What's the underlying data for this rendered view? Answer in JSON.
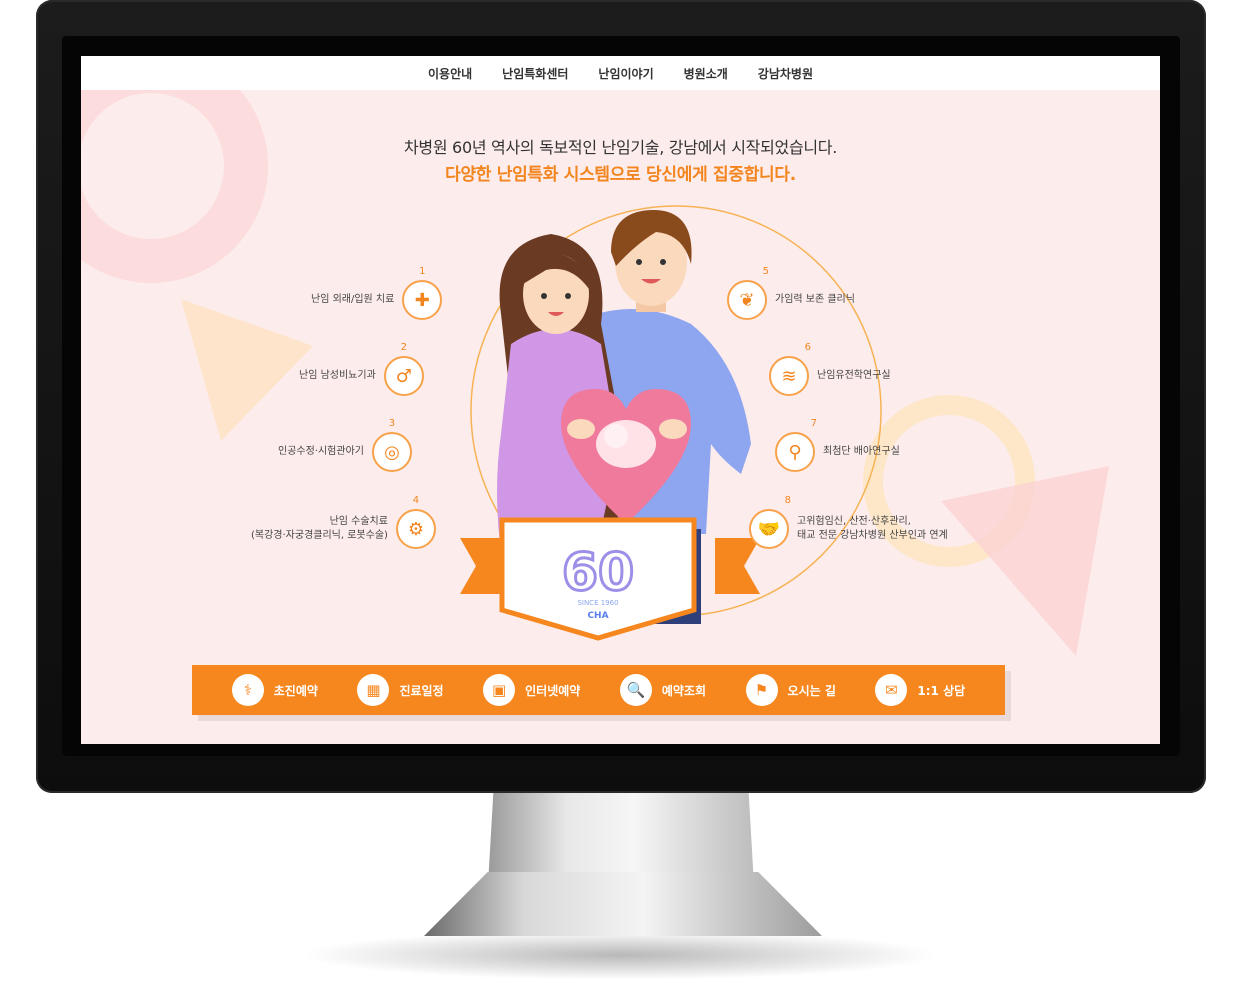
{
  "nav": [
    "이용안내",
    "난임특화센터",
    "난임이야기",
    "병원소개",
    "강남차병원"
  ],
  "headline": {
    "line1": "차병원 60년 역사의 독보적인 난임기술, 강남에서 시작되었습니다.",
    "line2": "다양한 난임특화 시스템으로 당신에게 집중합니다."
  },
  "services_left": [
    {
      "num": "1",
      "label": "난임 외래/입원 치료",
      "icon": "nurse-icon"
    },
    {
      "num": "2",
      "label": "난임 남성비뇨기과",
      "icon": "male-symbol-icon"
    },
    {
      "num": "3",
      "label": "인공수정·시험관아기",
      "icon": "egg-sperm-icon"
    },
    {
      "num": "4",
      "label": "난임 수술치료\n(복강경·자궁경클리닉, 로봇수술)",
      "icon": "robot-arm-icon"
    }
  ],
  "services_right": [
    {
      "num": "5",
      "label": "가임력 보존 클리닉",
      "icon": "uterus-icon"
    },
    {
      "num": "6",
      "label": "난임유전학연구실",
      "icon": "dna-icon"
    },
    {
      "num": "7",
      "label": "최첨단 배아연구실",
      "icon": "microscope-icon"
    },
    {
      "num": "8",
      "label": "고위험임신, 산전·산후관리,\n태교 전문 강남차병원 산부인과 연계",
      "icon": "handshake-icon"
    }
  ],
  "emblem": {
    "number": "60",
    "since": "SINCE 1960",
    "brand": "CHA"
  },
  "quick_menu": [
    {
      "label": "초진예약",
      "icon": "stethoscope-icon",
      "glyph": "⚕"
    },
    {
      "label": "진료일정",
      "icon": "calendar-icon",
      "glyph": "▦"
    },
    {
      "label": "인터넷예약",
      "icon": "monitor-icon",
      "glyph": "▣"
    },
    {
      "label": "예약조회",
      "icon": "document-search-icon",
      "glyph": "🔍"
    },
    {
      "label": "오시는 길",
      "icon": "flag-icon",
      "glyph": "⚑"
    },
    {
      "label": "1:1 상담",
      "icon": "chat-icon",
      "glyph": "✉"
    }
  ],
  "colors": {
    "accent": "#f3851f",
    "bg": "#fdecec",
    "bar": "#f6871f"
  }
}
